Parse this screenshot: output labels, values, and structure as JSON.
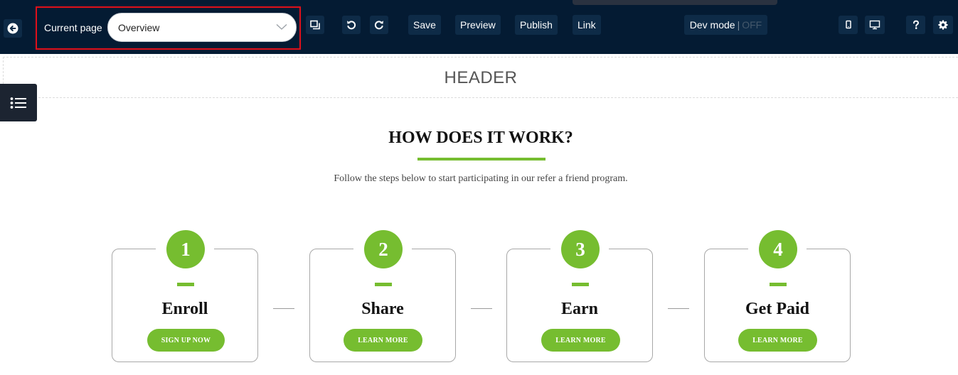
{
  "toolbar": {
    "current_page_label": "Current page",
    "current_page_value": "Overview",
    "save_label": "Save",
    "preview_label": "Preview",
    "publish_label": "Publish",
    "link_label": "Link",
    "dev_mode_label": "Dev mode",
    "dev_mode_separator": "|",
    "dev_mode_state": "OFF",
    "icons": [
      "back-arrow-icon",
      "chevron-down-icon",
      "duplicate-icon",
      "undo-icon",
      "redo-icon",
      "mobile-icon",
      "desktop-icon",
      "help-icon",
      "gear-icon"
    ]
  },
  "sidebar": {
    "icon": "list-icon"
  },
  "header": {
    "title": "HEADER"
  },
  "content": {
    "title": "HOW DOES IT WORK?",
    "subtitle": "Follow the steps below to start participating in our refer a friend program.",
    "steps": [
      {
        "number": "1",
        "title": "Enroll",
        "button": "SIGN UP NOW"
      },
      {
        "number": "2",
        "title": "Share",
        "button": "LEARN MORE"
      },
      {
        "number": "3",
        "title": "Earn",
        "button": "LEARN MORE"
      },
      {
        "number": "4",
        "title": "Get Paid",
        "button": "LEARN MORE"
      }
    ]
  },
  "colors": {
    "toolbar_bg": "#041b33",
    "toolbar_button_bg": "#0e2b47",
    "accent_green": "#76bd30",
    "highlight_red": "#e0101a"
  }
}
